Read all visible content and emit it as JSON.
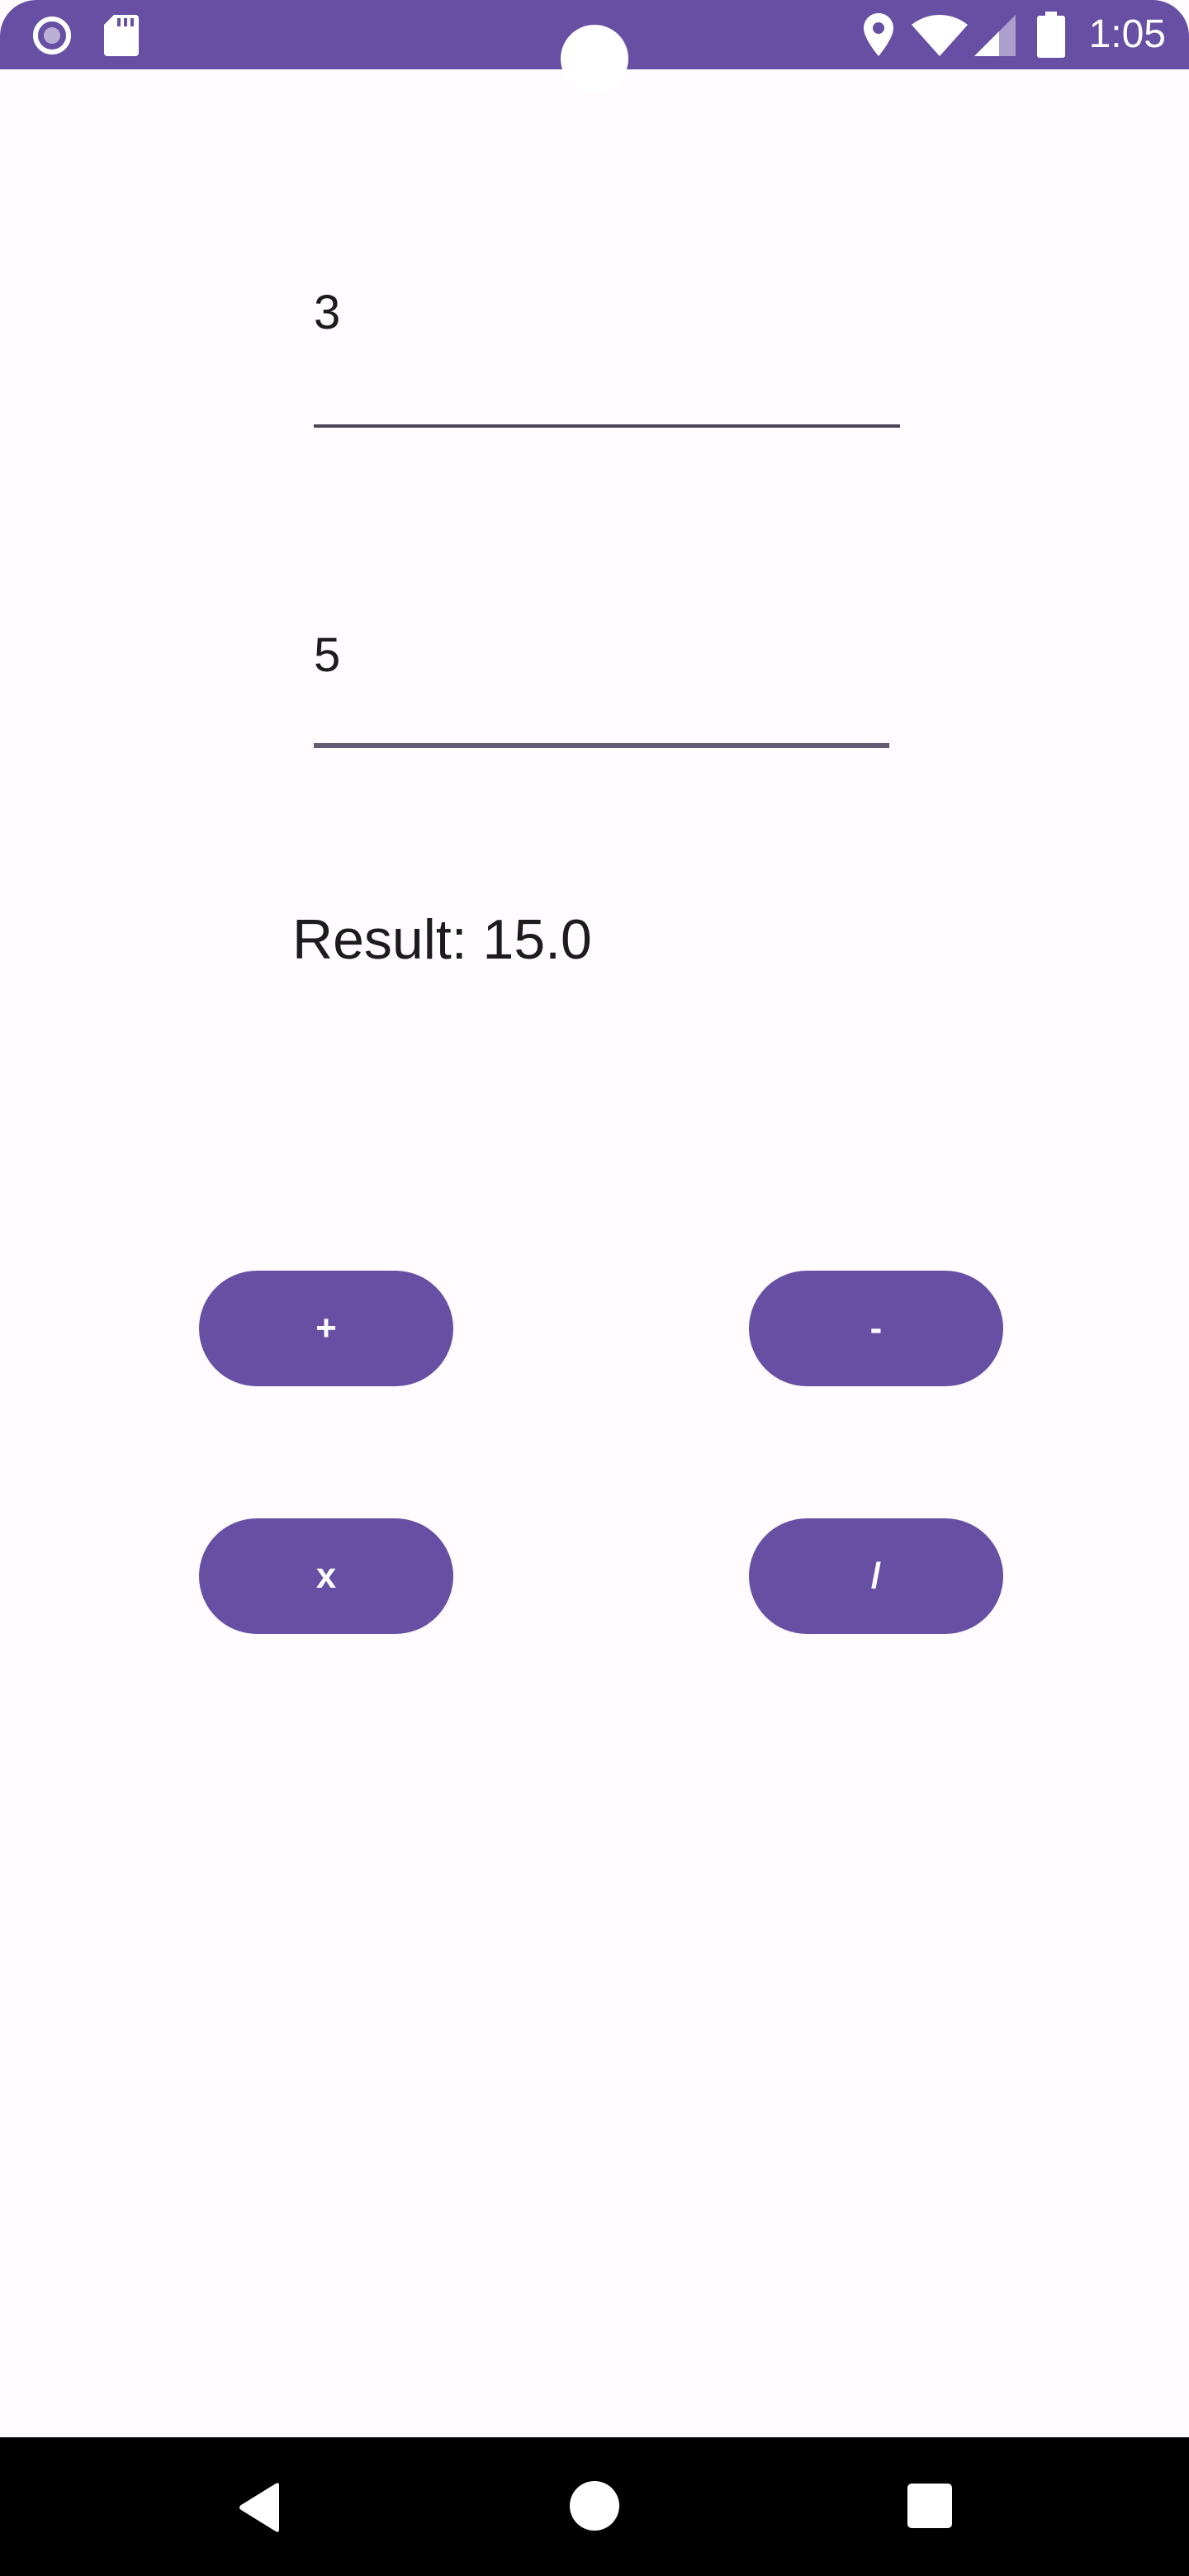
{
  "status_bar": {
    "time": "1:05",
    "icons": [
      "screen-record-icon",
      "sd-card-icon",
      "location-icon",
      "wifi-icon",
      "cellular-signal-icon",
      "battery-icon"
    ]
  },
  "inputs": {
    "first_number": "3",
    "second_number": "5"
  },
  "result": {
    "text": "Result: 15.0"
  },
  "operations": {
    "add": "+",
    "subtract": "-",
    "multiply": "x",
    "divide": "/"
  },
  "nav_bar": {
    "icons": [
      "back-icon",
      "home-icon",
      "recents-icon"
    ]
  },
  "colors": {
    "primary": "#6750a4",
    "background": "#fffbfe",
    "text": "#1c1b1f",
    "nav_bar": "#000000"
  }
}
